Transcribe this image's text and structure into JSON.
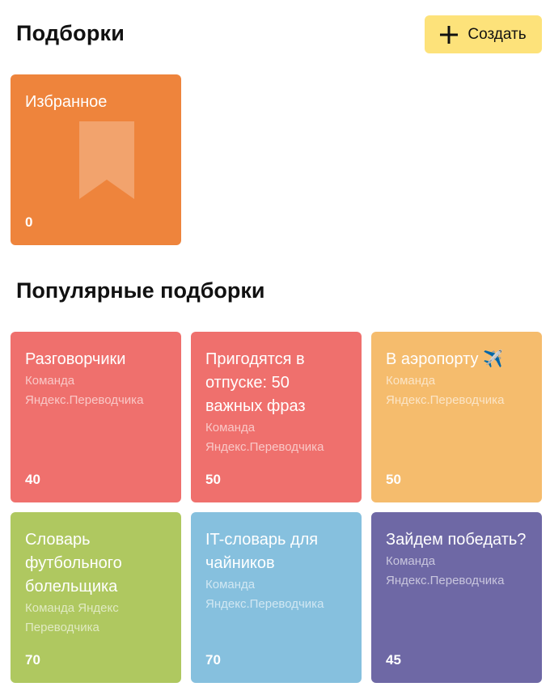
{
  "header": {
    "title": "Подборки",
    "create_label": "Создать"
  },
  "favorites": {
    "title": "Избранное",
    "count": "0"
  },
  "popular": {
    "title": "Популярные подборки",
    "cards": [
      {
        "title": "Разговорчики",
        "author": "Команда Яндекс.Переводчика",
        "count": "40"
      },
      {
        "title": "Пригодятся в отпуске: 50 важных фраз",
        "author": "Команда Яндекс.Переводчика",
        "count": "50"
      },
      {
        "title": "В аэропорту",
        "emoji": "✈️",
        "author": "Команда Яндекс.Переводчика",
        "count": "50"
      },
      {
        "title": "Словарь футбольного болельщика",
        "author": "Команда Яндекс Переводчика",
        "count": "70"
      },
      {
        "title": "IT-словарь для чайников",
        "author": "Команда Яндекс.Переводчика",
        "count": "70"
      },
      {
        "title": "Зайдем победать?",
        "author": "Команда Яндекс.Переводчика",
        "count": "45"
      }
    ]
  },
  "colors": {
    "favorites": "#ee843c",
    "red": "#ef706d",
    "orange": "#f5bc6d",
    "green": "#afc860",
    "blue": "#86c0de",
    "purple": "#6e68a5",
    "create_button": "#fde27a"
  }
}
